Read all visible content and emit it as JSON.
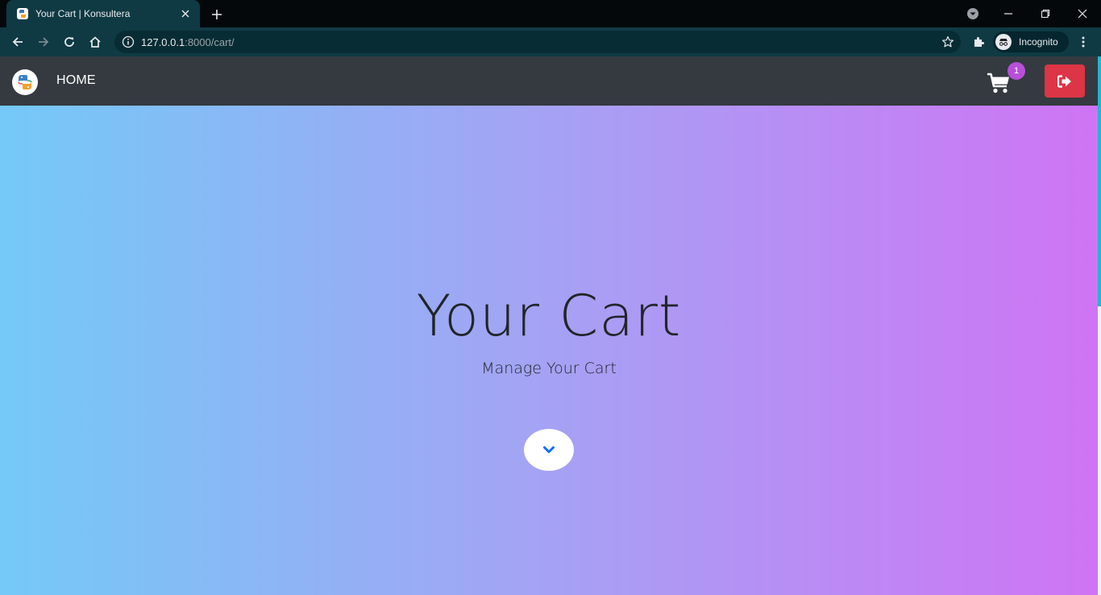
{
  "browser": {
    "tab": {
      "title": "Your Cart | Konsultera",
      "favicon": "python-logo-icon"
    },
    "address_bar": {
      "host": "127.0.0.1",
      "path": ":8000/cart/"
    },
    "profile": {
      "label": "Incognito"
    },
    "icons": [
      "back-icon",
      "forward-icon",
      "reload-icon",
      "home-icon",
      "site-info-icon",
      "bookmark-star-icon",
      "extensions-icon",
      "menu-icon",
      "tab-search-icon",
      "minimize-icon",
      "restore-icon",
      "close-window-icon"
    ],
    "colors": {
      "frame": "#05080a",
      "toolbar": "#0f3a44",
      "omnibox": "#072c34"
    }
  },
  "navbar": {
    "brand_icon": "python-logo-icon",
    "home_label": "HOME",
    "cart_icon": "cart-icon",
    "cart_count": "1",
    "logout_icon": "sign-out-icon",
    "colors": {
      "background": "#343a40",
      "badge": "#b650d8",
      "logout": "#dc3545"
    }
  },
  "hero": {
    "title": "Your Cart",
    "subtitle": "Manage Your Cart",
    "scroll_icon": "chevron-down-icon",
    "gradient": [
      "#74c9f7",
      "#a5a2f4",
      "#cf74f4"
    ]
  }
}
